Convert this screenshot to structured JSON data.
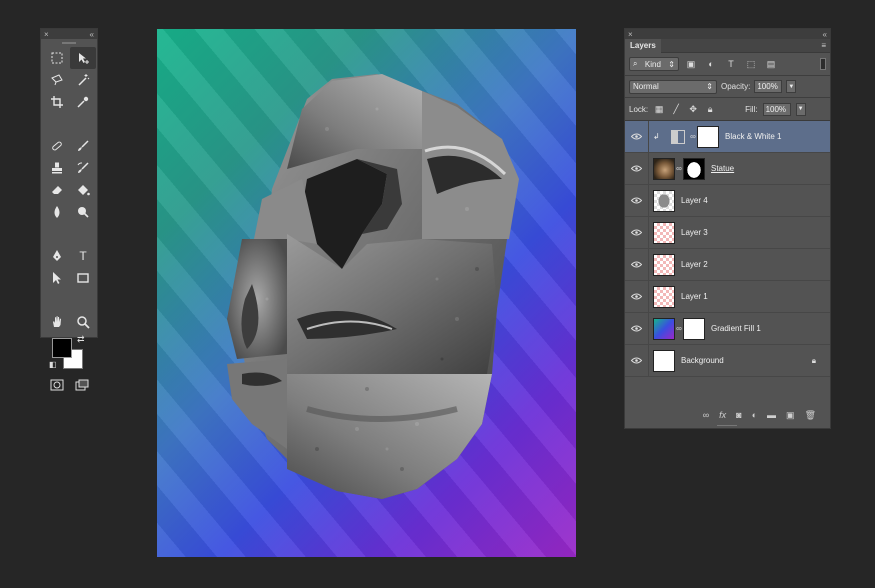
{
  "tools_panel": {
    "close_glyph": "×",
    "collapse_glyph": "«",
    "tools": [
      {
        "name": "marquee-tool-icon"
      },
      {
        "name": "move-tool-icon",
        "active": true
      },
      {
        "name": "lasso-tool-icon"
      },
      {
        "name": "magic-wand-tool-icon"
      },
      {
        "name": "crop-tool-icon"
      },
      {
        "name": "eyedropper-tool-icon"
      },
      {
        "name": "healing-brush-tool-icon"
      },
      {
        "name": "brush-tool-icon"
      },
      {
        "name": "clone-stamp-tool-icon"
      },
      {
        "name": "history-brush-tool-icon"
      },
      {
        "name": "eraser-tool-icon"
      },
      {
        "name": "paint-bucket-tool-icon"
      },
      {
        "name": "blur-tool-icon"
      },
      {
        "name": "dodge-tool-icon"
      },
      {
        "name": "pen-tool-icon"
      },
      {
        "name": "type-tool-icon",
        "glyph": "T"
      },
      {
        "name": "path-selection-tool-icon"
      },
      {
        "name": "rectangle-tool-icon"
      },
      {
        "name": "hand-tool-icon"
      },
      {
        "name": "zoom-tool-icon"
      }
    ],
    "foreground_color": "#000000",
    "background_color": "#ffffff"
  },
  "layers_panel": {
    "close_glyph": "×",
    "collapse_glyph": "«",
    "tab_label": "Layers",
    "menu_glyph": "≡",
    "filter": {
      "label": "Kind"
    },
    "blend_mode": "Normal",
    "opacity_label": "Opacity:",
    "opacity_value": "100%",
    "lock_label": "Lock:",
    "fill_label": "Fill:",
    "fill_value": "100%",
    "layers": [
      {
        "name": "Black & White 1",
        "type": "adjustment",
        "selected": true,
        "clipped": true
      },
      {
        "name": "Statue",
        "type": "masked-image",
        "underlined": true
      },
      {
        "name": "Layer 4",
        "type": "pixel-gray"
      },
      {
        "name": "Layer 3",
        "type": "pixel"
      },
      {
        "name": "Layer 2",
        "type": "pixel"
      },
      {
        "name": "Layer 1",
        "type": "pixel"
      },
      {
        "name": "Gradient Fill 1",
        "type": "gradient-fill"
      },
      {
        "name": "Background",
        "type": "background",
        "locked": true
      }
    ]
  },
  "canvas": {
    "gradient_colors": [
      "#17b48c",
      "#3f78c8",
      "#3a4ee0",
      "#9a28c8"
    ]
  }
}
